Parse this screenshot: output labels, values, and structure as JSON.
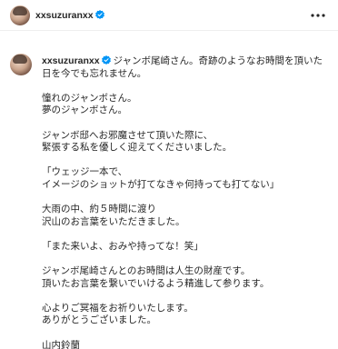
{
  "header": {
    "username": "xxsuzuranxx",
    "more_icon": "more-horizontal-icon"
  },
  "post": {
    "username": "xxsuzuranxx",
    "caption_first": "ジャンボ尾崎さん。奇跡のようなお時間を頂いた",
    "caption_lines": [
      "日を今でも忘れません。",
      "",
      "憧れのジャンボさん。",
      "夢のジャンボさん。",
      "",
      "ジャンボ邸へお邪魔させて頂いた際に、",
      "緊張する私を優しく迎えてくださいました。",
      "",
      "「ウェッジ一本で、",
      "イメージのショットが打てなきゃ何持っても打てない」",
      "",
      "大雨の中、約５時間に渡り",
      "沢山のお言葉をいただきました。",
      "",
      "「また来いよ、おみや持ってな！笑」",
      "",
      "ジャンボ尾崎さんとのお時間は人生の財産です。",
      "頂いたお言葉を繋いでいけるよう精進して参ります。",
      "",
      "心よりご冥福をお祈りいたします。",
      "ありがとうございました。",
      "",
      "山内鈴蘭"
    ]
  },
  "colors": {
    "verified": "#0095f6",
    "text": "#262626",
    "divider": "#efefef"
  }
}
